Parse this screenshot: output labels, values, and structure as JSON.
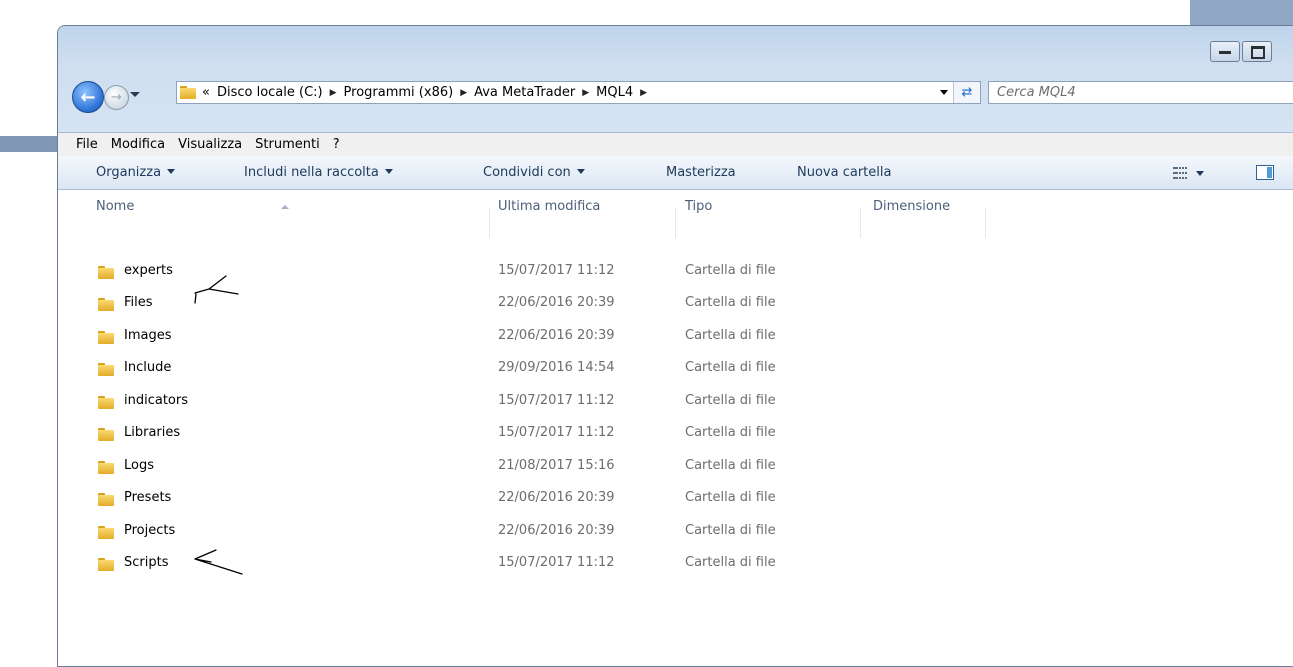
{
  "window": {
    "title_buttons": [
      "minimize",
      "maximize"
    ]
  },
  "address_bar": {
    "overflow": "«",
    "crumbs": [
      "Disco locale (C:)",
      "Programmi (x86)",
      "Ava MetaTrader",
      "MQL4"
    ]
  },
  "search": {
    "placeholder": "Cerca MQL4"
  },
  "menu": [
    "File",
    "Modifica",
    "Visualizza",
    "Strumenti",
    "?"
  ],
  "toolbar": {
    "organize": "Organizza",
    "include": "Includi nella raccolta",
    "share": "Condividi con",
    "burn": "Masterizza",
    "new_folder": "Nuova cartella"
  },
  "columns": {
    "name": "Nome",
    "modified": "Ultima modifica",
    "type": "Tipo",
    "size": "Dimensione"
  },
  "files": [
    {
      "name": "experts",
      "modified": "15/07/2017 11:12",
      "type": "Cartella di file"
    },
    {
      "name": "Files",
      "modified": "22/06/2016 20:39",
      "type": "Cartella di file"
    },
    {
      "name": "Images",
      "modified": "22/06/2016 20:39",
      "type": "Cartella di file"
    },
    {
      "name": "Include",
      "modified": "29/09/2016 14:54",
      "type": "Cartella di file"
    },
    {
      "name": "indicators",
      "modified": "15/07/2017 11:12",
      "type": "Cartella di file"
    },
    {
      "name": "Libraries",
      "modified": "15/07/2017 11:12",
      "type": "Cartella di file"
    },
    {
      "name": "Logs",
      "modified": "21/08/2017 15:16",
      "type": "Cartella di file"
    },
    {
      "name": "Presets",
      "modified": "22/06/2016 20:39",
      "type": "Cartella di file"
    },
    {
      "name": "Projects",
      "modified": "22/06/2016 20:39",
      "type": "Cartella di file"
    },
    {
      "name": "Scripts",
      "modified": "15/07/2017 11:12",
      "type": "Cartella di file"
    }
  ],
  "icons": {
    "back": "back-arrow-icon",
    "forward": "forward-arrow-icon",
    "folder": "folder-icon",
    "refresh": "refresh-icon",
    "views": "views-icon",
    "preview_pane": "preview-pane-icon"
  }
}
